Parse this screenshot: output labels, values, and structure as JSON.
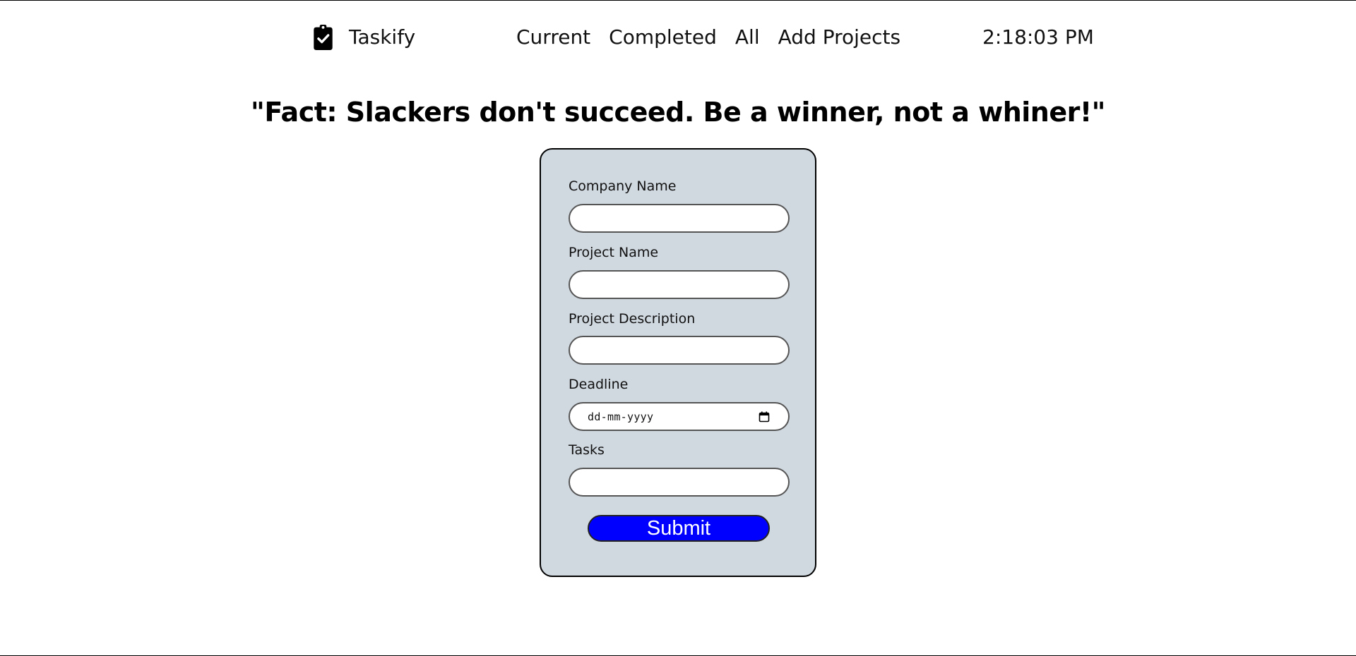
{
  "navbar": {
    "brand_icon": "clipboard-check-icon",
    "brand_name": "Taskify",
    "links": [
      "Current",
      "Completed",
      "All",
      "Add Projects"
    ],
    "time": "2:18:03 PM"
  },
  "quote": "\"Fact: Slackers don't succeed. Be a winner, not a whiner!\"",
  "form": {
    "fields": [
      {
        "label": "Company Name",
        "value": ""
      },
      {
        "label": "Project Name",
        "value": ""
      },
      {
        "label": "Project Description",
        "value": ""
      },
      {
        "label": "Deadline",
        "placeholder": "dd-mm-yyyy",
        "icon": "calendar-icon"
      },
      {
        "label": "Tasks",
        "value": ""
      }
    ],
    "submit_label": "Submit"
  },
  "colors": {
    "form_background": "#d0d8e0",
    "submit_button": "#0000ff"
  }
}
